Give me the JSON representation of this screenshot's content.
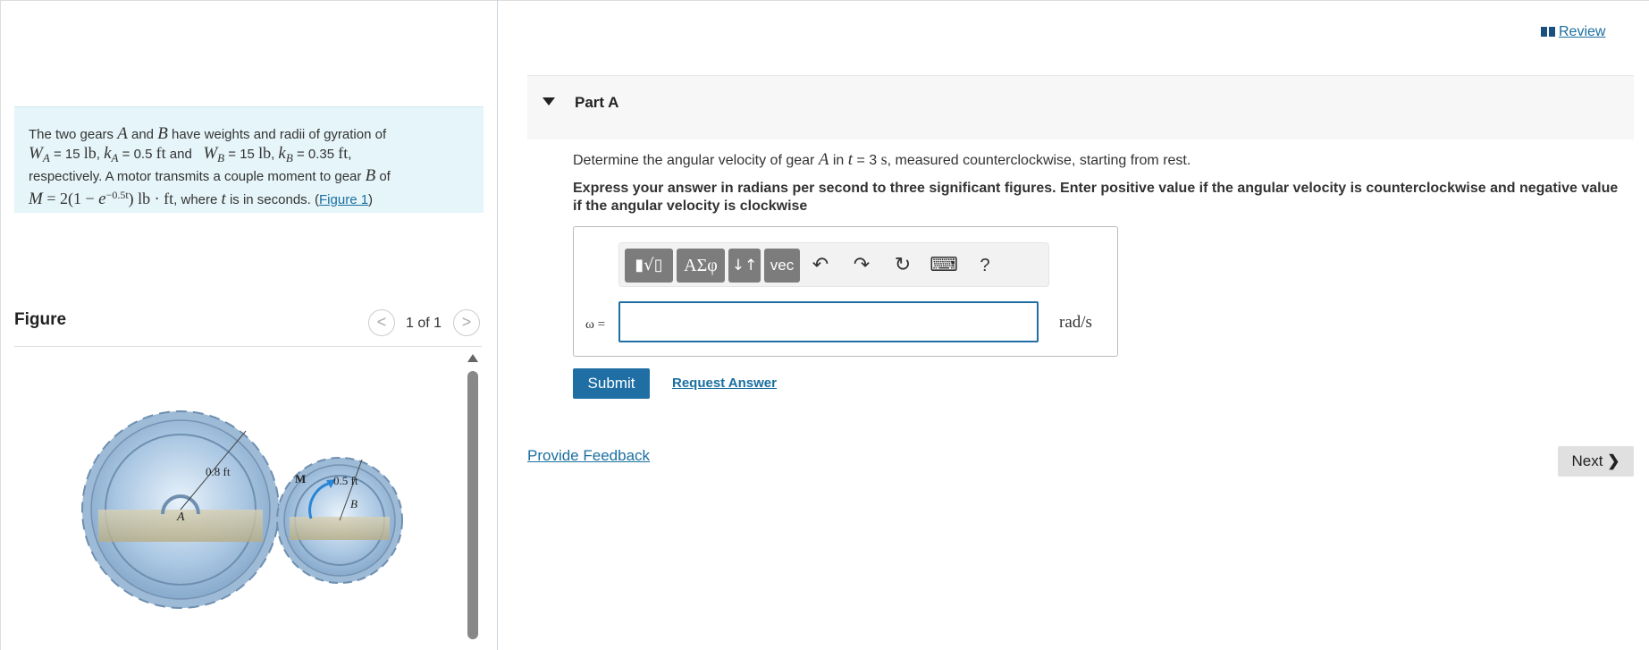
{
  "figure_panel": {
    "problem": {
      "p1": "The two gears ",
      "gear_a": "A",
      "p2": " and ",
      "gear_b": "B",
      "p3": " have weights and radii of gyration of",
      "wa_sym": "W",
      "wa_sub": "A",
      "wa_val": " = 15 ",
      "wa_unit": "lb",
      "ka_sym": "k",
      "ka_sub": "A",
      "ka_val": " = 0.5 ",
      "ka_unit": "ft",
      "and_text": " and ",
      "wb_sym": "W",
      "wb_sub": "B",
      "wb_val": " = 15 ",
      "wb_unit": "lb",
      "kb_sym": "k",
      "kb_sub": "B",
      "kb_val": " = 0.35 ",
      "kb_unit": "ft",
      "comma": ",",
      "p4": "respectively. A motor transmits a couple moment to gear ",
      "p4b": " of",
      "m_expr": "M",
      "m_eq": " = 2(1 − ",
      "m_e": "e",
      "m_exp": "−0.5t",
      "m_close": ") lb · ft",
      "p5": ", where ",
      "t_sym": "t",
      "p6": " is in seconds. (",
      "fig_link": "Figure 1",
      "p7": ")"
    },
    "figure_heading": "Figure",
    "prev_symbol": "<",
    "counter": "1 of 1",
    "next_symbol": ">",
    "figure_labels": {
      "radius_a": "0.8 ft",
      "radius_b": "0.5 ft",
      "moment": "M",
      "label_a": "A",
      "label_b": "B"
    }
  },
  "review_link": "Review",
  "part": {
    "title": "Part A",
    "question_pre": "Determine the angular velocity of gear ",
    "question_gear": "A",
    "question_in": " in ",
    "question_t": "t",
    "question_eq": " = 3 ",
    "question_s": "s",
    "question_post": ", measured counterclockwise, starting from rest.",
    "instructions": "Express your answer in radians per second to three significant figures. Enter positive value if the angular velocity is counterclockwise and negative value if the angular velocity is clockwise"
  },
  "toolbar": {
    "templates": "▮√▯",
    "greek": "ΑΣφ",
    "arrows": "↓↑",
    "vec": "vec",
    "undo": "↶",
    "redo": "↷",
    "reset": "↻",
    "keyboard": "⌨",
    "help": "?"
  },
  "answer": {
    "variable": "ω =",
    "value": "",
    "unit": "rad/s"
  },
  "buttons": {
    "submit": "Submit",
    "request_answer": "Request Answer",
    "provide_feedback": "Provide Feedback",
    "next": "Next"
  }
}
